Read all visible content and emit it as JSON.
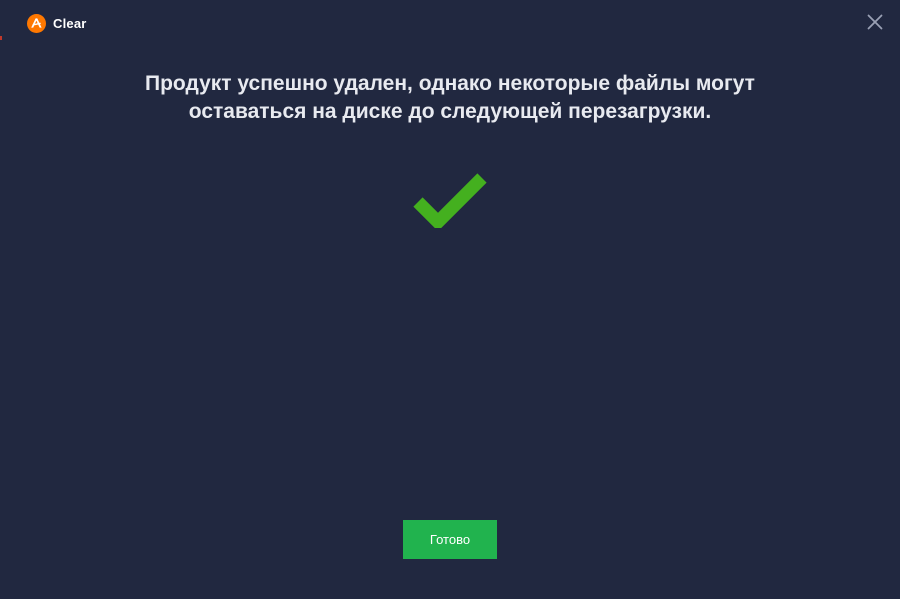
{
  "app": {
    "title": "Clear",
    "logo_icon": "avast-logo-icon",
    "logo_color": "#ff7800"
  },
  "window": {
    "close_icon": "close-icon"
  },
  "main": {
    "message_line1": "Продукт успешно удален, однако некоторые файлы могут",
    "message_line2": "оставаться на диске до следующей перезагрузки.",
    "status_icon": "checkmark-icon",
    "status_color": "#44b01f"
  },
  "footer": {
    "done_label": "Готово",
    "done_color": "#21b34e"
  }
}
